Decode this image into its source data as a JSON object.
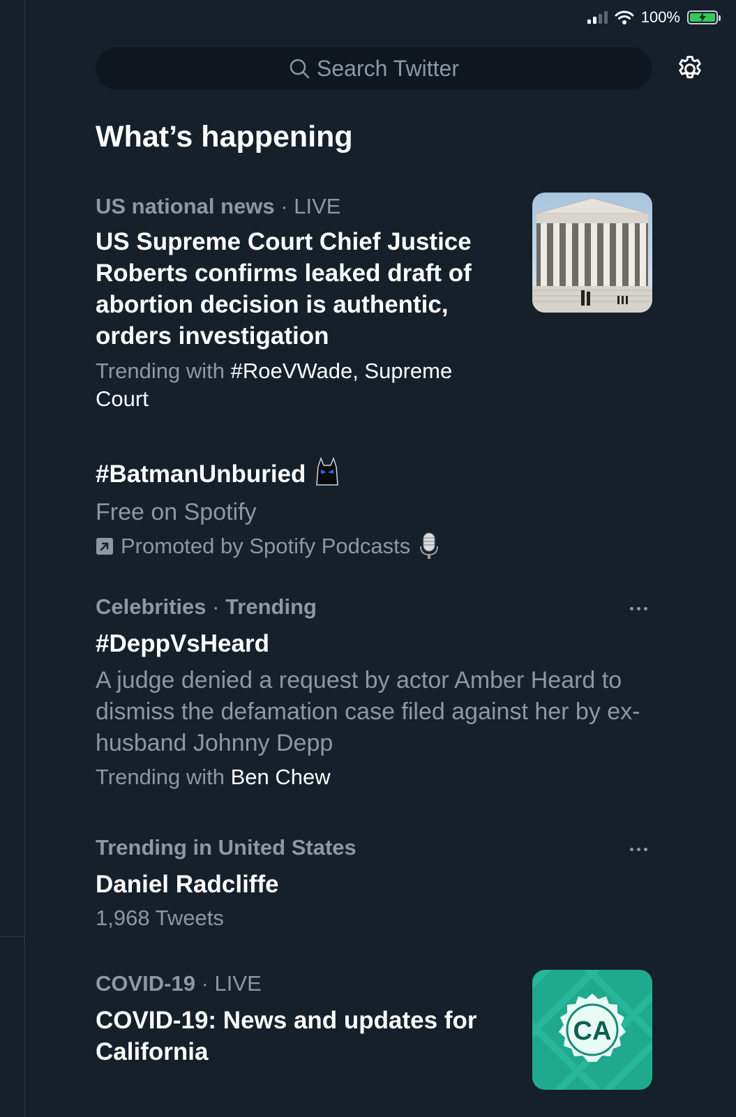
{
  "status_bar": {
    "battery_percent": "100%"
  },
  "search": {
    "placeholder": "Search Twitter"
  },
  "section": {
    "title": "What’s happening"
  },
  "trends": [
    {
      "category": "US national news",
      "tag": "LIVE",
      "headline": "US Supreme Court Chief Justice Roberts confirms leaked draft of abortion decision is authentic, orders investigation",
      "trending_prefix": "Trending with",
      "trending_with": "#RoeVWade, Supreme Court",
      "image": "supreme-court-building"
    },
    {
      "headline": "#BatmanUnburied",
      "headline_emoji": "batman-cowl",
      "subtitle": "Free on Spotify",
      "promoted_text": "Promoted by Spotify Podcasts",
      "promoted_emoji": "microphone"
    },
    {
      "category": "Celebrities",
      "tag": "Trending",
      "headline": "#DeppVsHeard",
      "description": "A judge denied a request by actor Amber Heard to dismiss the defamation case filed against her by ex-husband Johnny Depp",
      "trending_prefix": "Trending with",
      "trending_with": "Ben Chew"
    },
    {
      "category": "Trending in United States",
      "headline": "Daniel Radcliffe",
      "tweet_count": "1,968 Tweets"
    },
    {
      "category": "COVID-19",
      "tag": "LIVE",
      "headline": "COVID-19: News and updates for California",
      "image_text": "CA"
    }
  ]
}
